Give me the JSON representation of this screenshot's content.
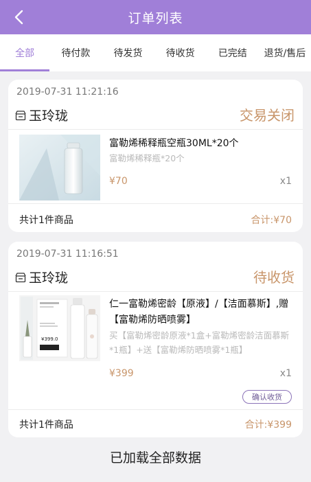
{
  "header": {
    "title": "订单列表"
  },
  "tabs": [
    "全部",
    "待付款",
    "待发货",
    "待收货",
    "已完结",
    "退货/售后"
  ],
  "colors": {
    "accent": "#a07fd8",
    "price": "#c8956a"
  },
  "orders": [
    {
      "date": "2019-07-31 11:21:16",
      "shop": "玉玲珑",
      "status": "交易关闭",
      "product_name": "富勒烯稀释瓶空瓶30ML*20个",
      "product_spec": "富勒烯稀释瓶*20个",
      "price": "¥70",
      "qty": "x1",
      "count_text": "共计1件商品",
      "total_text": "合计:¥70"
    },
    {
      "date": "2019-07-31 11:16:51",
      "shop": "玉玲珑",
      "status": "待收货",
      "product_name": "仁一富勒烯密龄【原液】/【洁面慕斯】,赠【富勒烯防晒喷雾】",
      "product_spec": "买【富勒烯密龄原液*1盒+富勒烯密龄洁面慕斯*1瓶】+送【富勒烯防晒喷雾*1瓶】",
      "price": "¥399",
      "qty": "x1",
      "button": "确认收货",
      "count_text": "共计1件商品",
      "total_text": "合计:¥399",
      "image_price": "¥399.0"
    }
  ],
  "footer": {
    "loaded_text": "已加载全部数据"
  }
}
